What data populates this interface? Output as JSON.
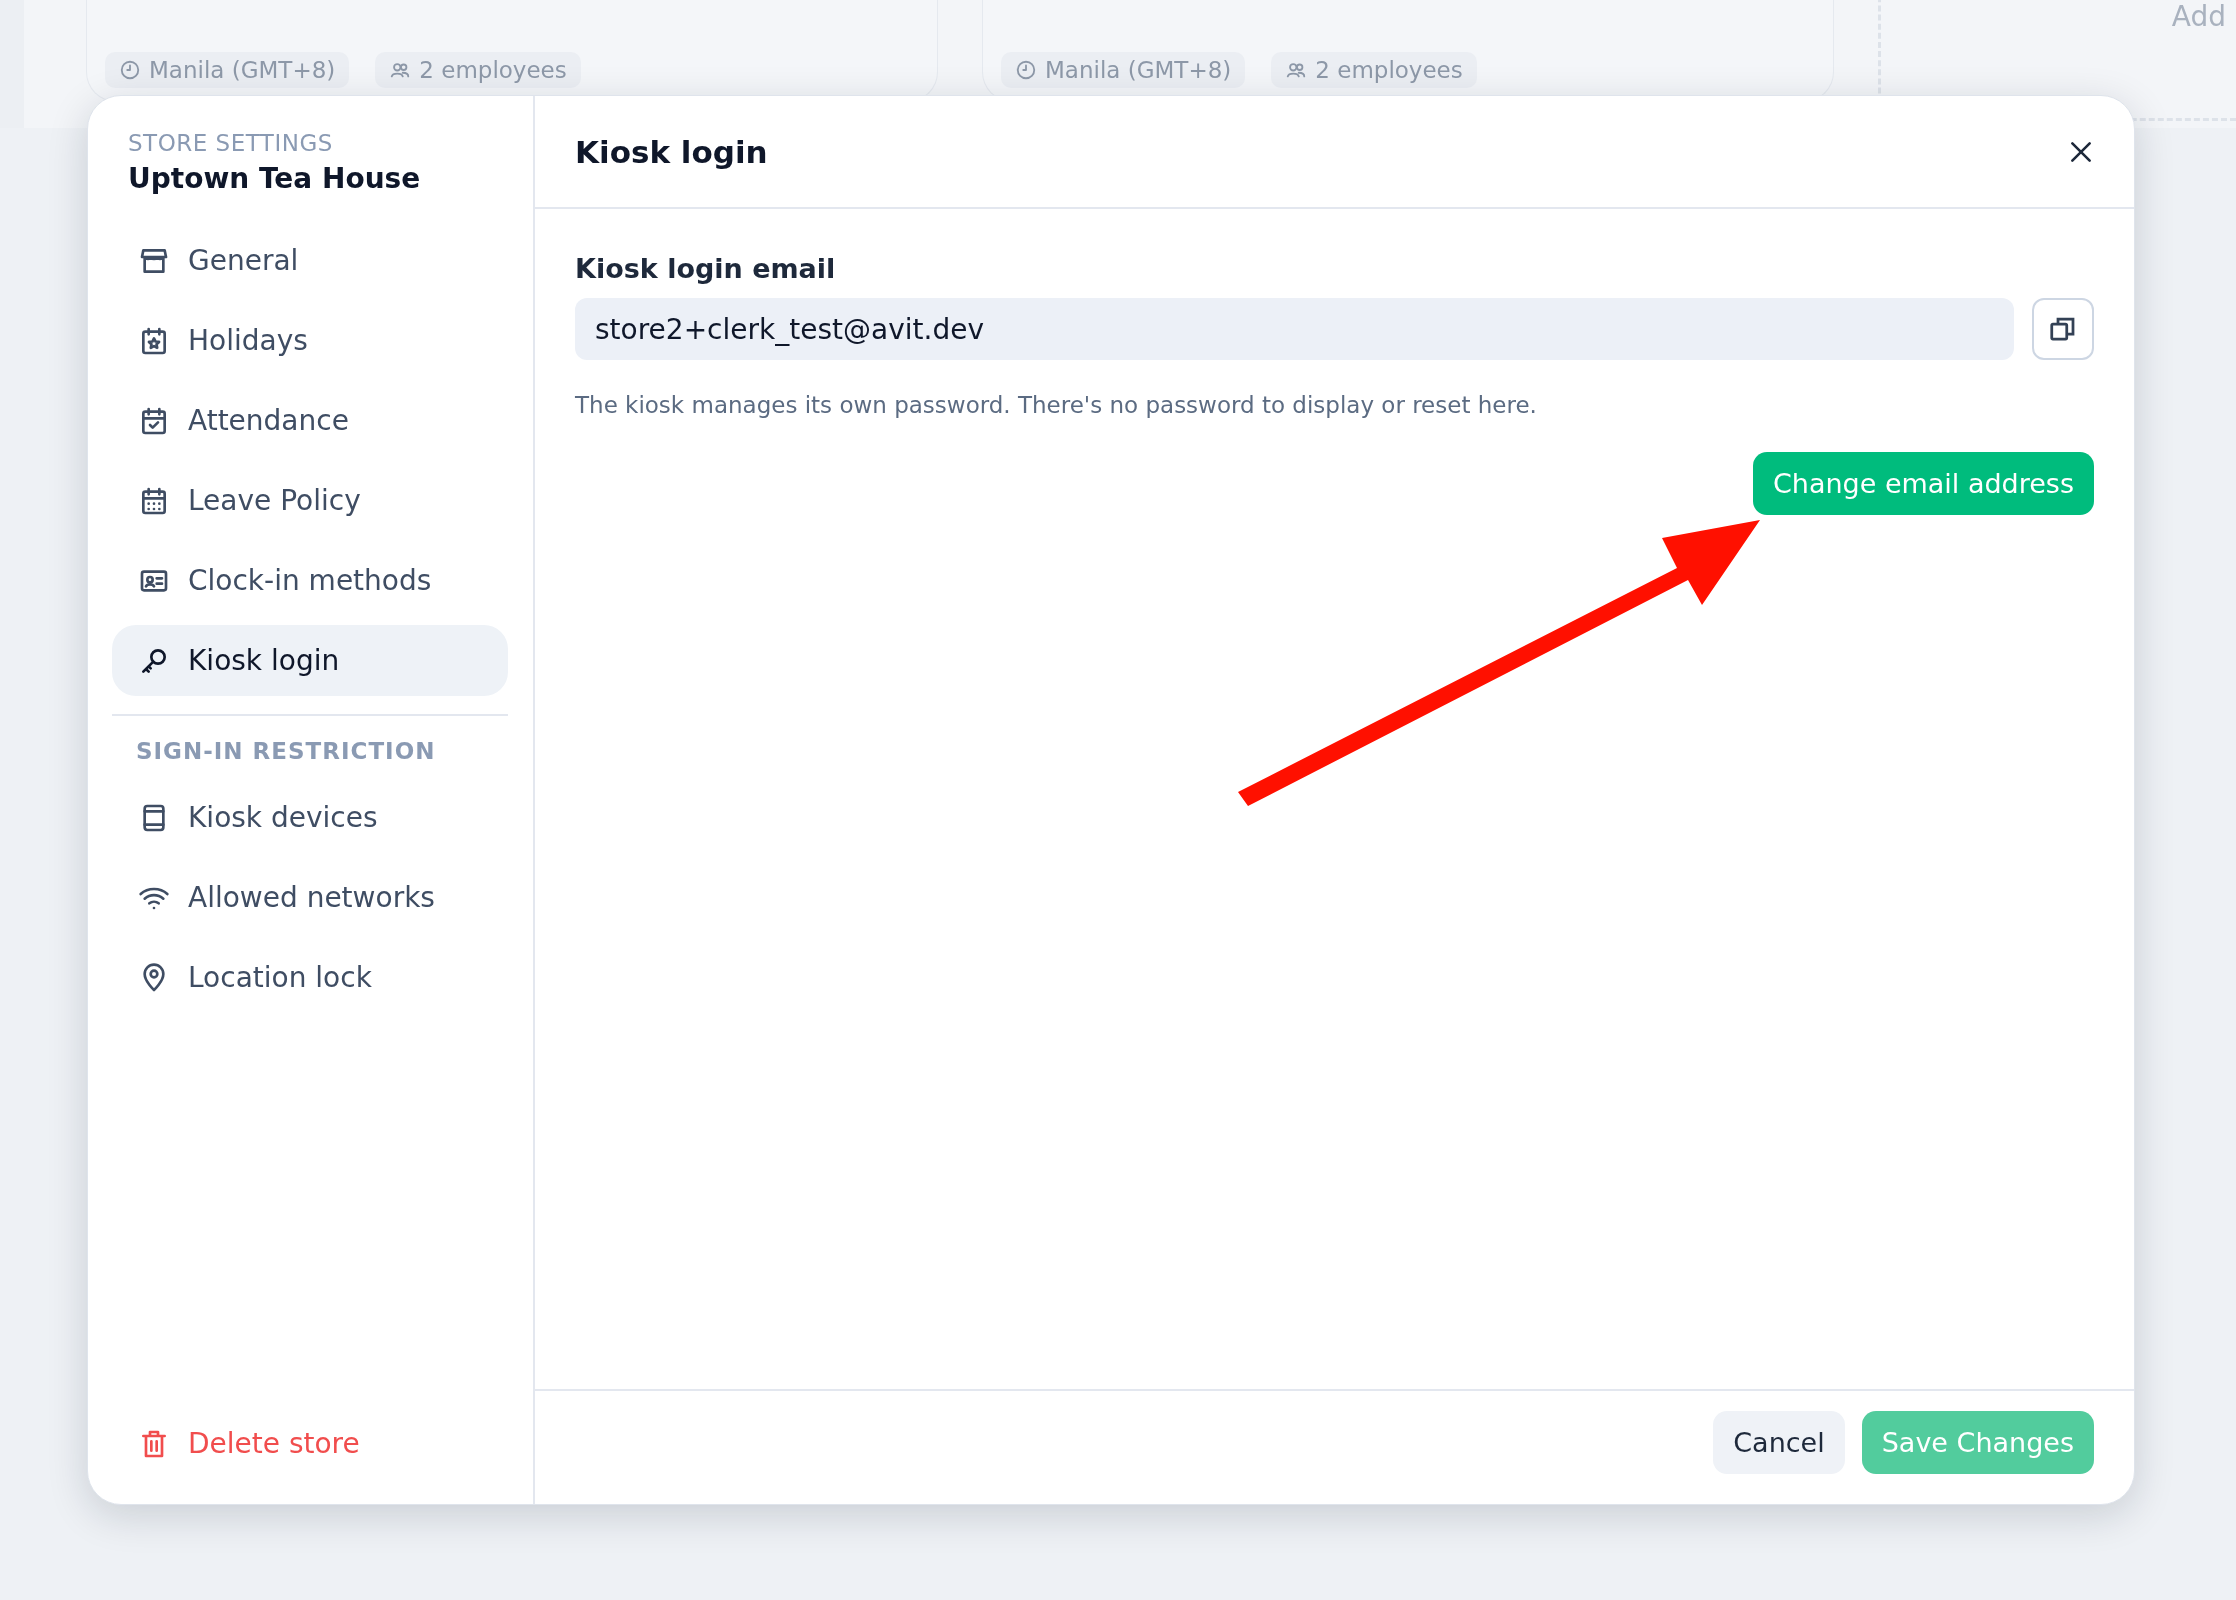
{
  "background": {
    "cards": [
      {
        "chips": [
          "Manila (GMT+8)",
          "2 employees"
        ]
      },
      {
        "chips": [
          "Manila (GMT+8)",
          "2 employees"
        ]
      }
    ],
    "add_tile": {
      "label": "Add"
    }
  },
  "dialog": {
    "sidebar": {
      "eyebrow": "STORE SETTINGS",
      "store_name": "Uptown Tea House",
      "items": [
        {
          "label": "General",
          "selected": false
        },
        {
          "label": "Holidays",
          "selected": false
        },
        {
          "label": "Attendance",
          "selected": false
        },
        {
          "label": "Leave Policy",
          "selected": false
        },
        {
          "label": "Clock-in methods",
          "selected": false
        },
        {
          "label": "Kiosk login",
          "selected": true
        }
      ],
      "section_title": "SIGN-IN RESTRICTION",
      "restriction_items": [
        {
          "label": "Kiosk devices",
          "selected": false
        },
        {
          "label": "Allowed networks",
          "selected": false
        },
        {
          "label": "Location lock",
          "selected": false
        }
      ],
      "delete_action": "Delete store"
    },
    "title": "Kiosk login",
    "email_field": {
      "label": "Kiosk login email",
      "value": "store2+clerk_test@avit.dev"
    },
    "help_text": "The kiosk manages its own password. There's no password to display or reset here.",
    "change_button": "Change email address",
    "footer_buttons": [
      {
        "label": "Cancel",
        "kind": "secondary",
        "disabled": false
      },
      {
        "label": "Save Changes",
        "kind": "primary",
        "disabled": true
      }
    ]
  }
}
